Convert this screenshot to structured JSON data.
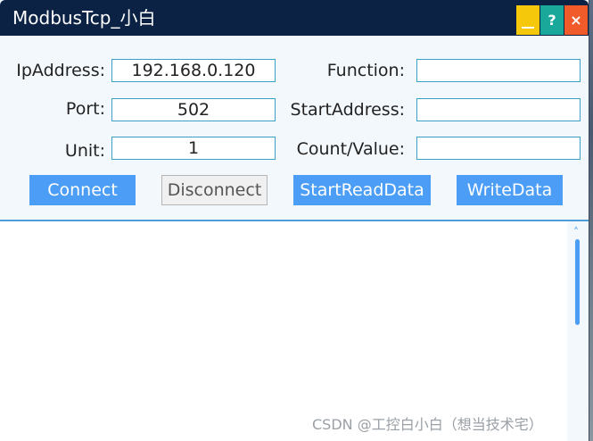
{
  "window": {
    "title": "ModbusTcp_小白",
    "controls": {
      "minimize_icon": "minimize-icon",
      "help_label": "?",
      "close_label": "×"
    }
  },
  "connection": {
    "ip_label": "IpAddress:",
    "ip_value": "192.168.0.120",
    "port_label": "Port:",
    "port_value": "502",
    "unit_label": "Unit:",
    "unit_value": "1"
  },
  "request": {
    "function_label": "Function:",
    "function_value": "",
    "start_address_label": "StartAddress:",
    "start_address_value": "",
    "count_label": "Count/Value:",
    "count_value": ""
  },
  "buttons": {
    "connect": "Connect",
    "disconnect": "Disconnect",
    "start_read": "StartReadData",
    "write": "WriteData"
  },
  "output": {
    "text": ""
  },
  "watermark": "CSDN @工控白小白（想当技术宅）",
  "colors": {
    "titlebar": "#0b2244",
    "accent": "#4b9df5",
    "minimize": "#f6c80b",
    "help": "#1aa89a",
    "close": "#f15b2a"
  }
}
